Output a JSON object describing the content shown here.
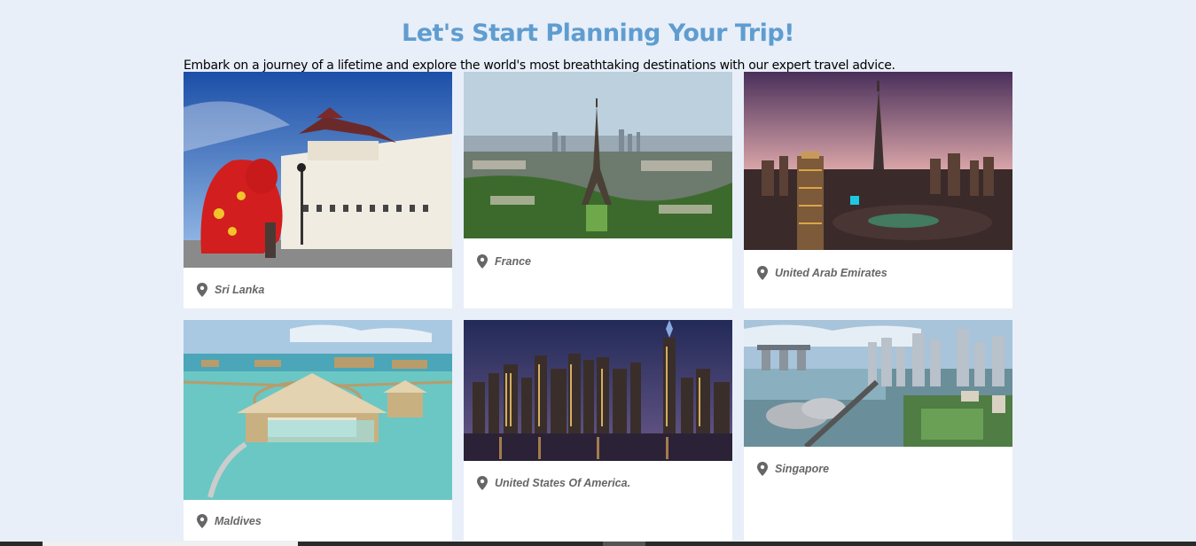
{
  "header": {
    "title": "Let's Start Planning Your Trip!",
    "intro": "Embark on a journey of a lifetime and explore the world's most breathtaking destinations with our expert travel advice."
  },
  "destinations": [
    {
      "name": "Sri Lanka",
      "icon": "location-pin-icon"
    },
    {
      "name": "France",
      "icon": "location-pin-icon"
    },
    {
      "name": "United Arab Emirates",
      "icon": "location-pin-icon"
    },
    {
      "name": "Maldives",
      "icon": "location-pin-icon"
    },
    {
      "name": "United States Of America.",
      "icon": "location-pin-icon"
    },
    {
      "name": "Singapore",
      "icon": "location-pin-icon"
    }
  ],
  "colors": {
    "background": "#e8eff9",
    "title": "#5f9dd0",
    "label": "#666666"
  }
}
